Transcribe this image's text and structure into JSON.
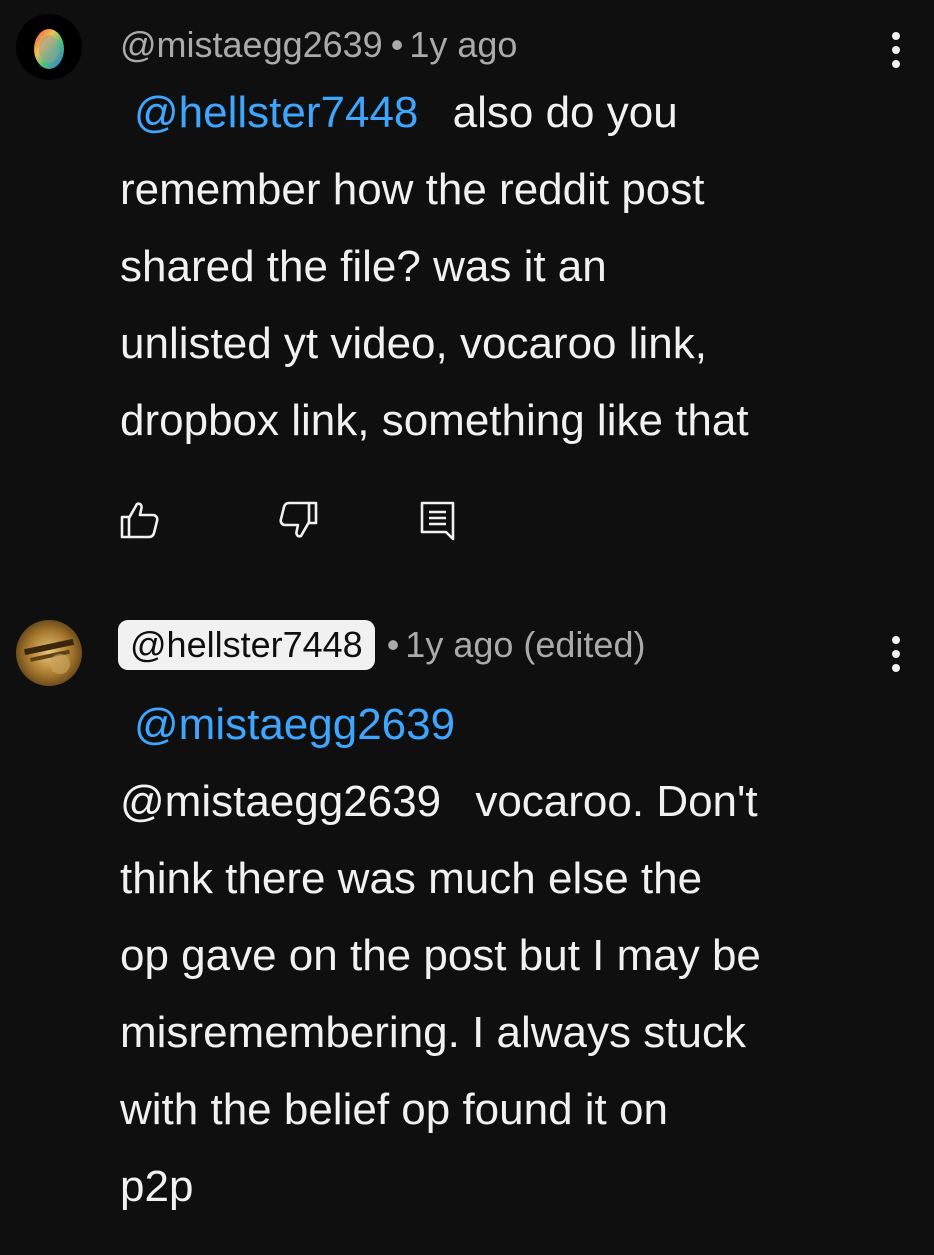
{
  "comments": [
    {
      "author": "@mistaegg2639",
      "separator": "•",
      "time": "1y ago",
      "mention": "@hellster7448",
      "body_lines": [
        "remember how the reddit post",
        "shared the file? was it an",
        "unlisted yt video, vocaroo link,",
        "dropbox link, something like that"
      ],
      "first_line_rest": "also do you",
      "avatar_icon": "egg-avatar",
      "more_icon": "vertical-dots-icon"
    },
    {
      "author": "@hellster7448",
      "separator": "•",
      "time": "1y ago (edited)",
      "reply_to": "@mistaegg2639",
      "mention": "@mistaegg2639",
      "first_line_rest": "vocaroo. Don't",
      "body_lines": [
        "think there was much else the",
        "op gave on the post but I may be",
        "misremembering. I always stuck",
        "with the belief op found it on",
        "p2p"
      ],
      "avatar_icon": "guitar-avatar",
      "more_icon": "vertical-dots-icon"
    }
  ],
  "actions": {
    "like_icon": "thumbs-up-icon",
    "dislike_icon": "thumbs-down-icon",
    "reply_icon": "reply-comment-icon"
  },
  "colors": {
    "background": "#0f0f0f",
    "text": "#f1f1f1",
    "meta": "#aaaaaa",
    "mention": "#3ea6ff"
  }
}
